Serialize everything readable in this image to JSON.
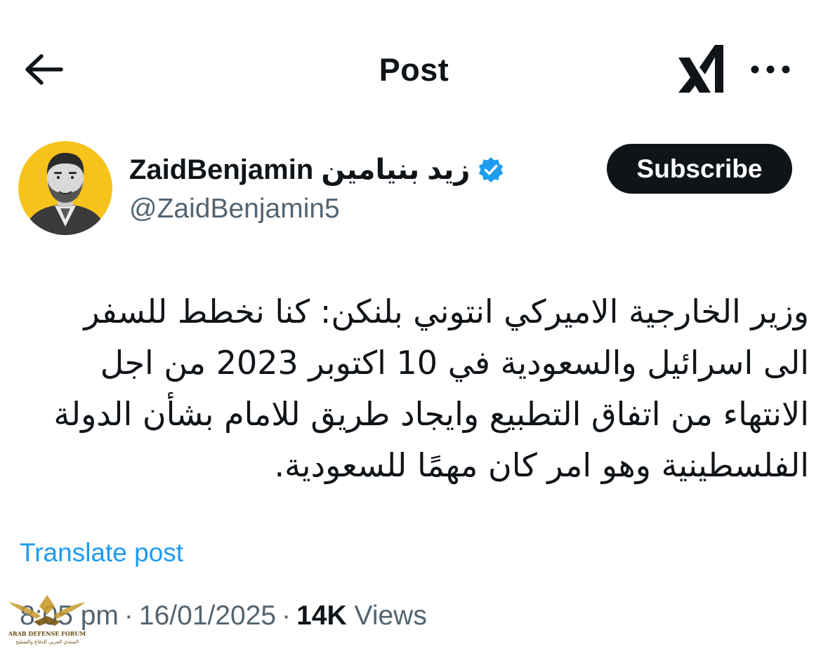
{
  "header": {
    "title": "Post",
    "back_icon": "arrow-left-icon",
    "logo_icon": "xai-logo",
    "more_icon": "more-horizontal-icon"
  },
  "author": {
    "display_name": "ZaidBenjamin زيد بنيامين",
    "handle": "@ZaidBenjamin5",
    "verified_icon": "verified-badge-icon",
    "avatar_background": "#f6c21b"
  },
  "subscribe_label": "Subscribe",
  "tweet": {
    "text": "وزير الخارجية الاميركي انتوني بلنكن: كنا نخطط للسفر الى اسرائيل والسعودية في 10 اكتوبر 2023 من اجل الانتهاء من اتفاق التطبيع وايجاد طريق للامام بشأن الدولة الفلسطينية وهو امر كان مهمًا للسعودية."
  },
  "translate_label": "Translate post",
  "meta": {
    "time": "8:05 pm",
    "separator": "·",
    "date": "16/01/2025",
    "views_count": "14K",
    "views_label": "Views"
  },
  "watermark": {
    "name_en": "ARAB DEFENSE FORUM",
    "name_ar": "المنتدى العربي للدفاع والتسليح"
  },
  "colors": {
    "text_primary": "#0f1419",
    "text_secondary": "#536471",
    "link": "#1d9bf0",
    "verified": "#1d9bf0",
    "button_bg": "#0f1419"
  }
}
